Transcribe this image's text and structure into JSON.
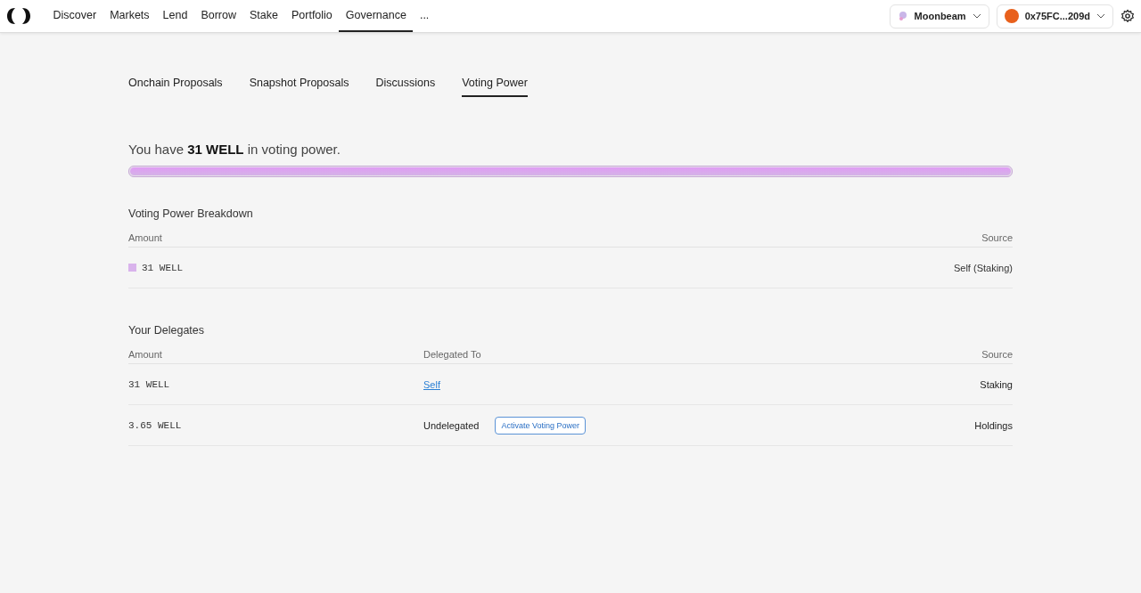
{
  "nav": {
    "items": [
      {
        "label": "Discover",
        "selected": false
      },
      {
        "label": "Markets",
        "selected": false
      },
      {
        "label": "Lend",
        "selected": false
      },
      {
        "label": "Borrow",
        "selected": false
      },
      {
        "label": "Stake",
        "selected": false
      },
      {
        "label": "Portfolio",
        "selected": false
      },
      {
        "label": "Governance",
        "selected": true
      },
      {
        "label": "...",
        "selected": false
      }
    ],
    "network": "Moonbeam",
    "account": "0x75FC...209d"
  },
  "tabs": [
    {
      "label": "Onchain Proposals",
      "selected": false
    },
    {
      "label": "Snapshot Proposals",
      "selected": false
    },
    {
      "label": "Discussions",
      "selected": false
    },
    {
      "label": "Voting Power",
      "selected": true
    }
  ],
  "summary": {
    "text": "You have **31 WELL** in voting power.",
    "level": 1
  },
  "breakdown": {
    "title": "Voting Power Breakdown",
    "columns": [
      "Amount",
      "Source"
    ],
    "rows": [
      {
        "amount": "31 WELL",
        "source": "Self (Staking)",
        "color": "#d9b3ec"
      }
    ]
  },
  "delegates": {
    "title": "Your Delegates",
    "columns": [
      "Amount",
      "Delegated To",
      "Source"
    ],
    "rows": [
      {
        "kind": "link",
        "amount": "31 WELL",
        "delegated_to": "Self",
        "source": "Staking"
      },
      {
        "kind": "undelegated",
        "amount": "3.65 WELL",
        "delegated_to": "Undelegated",
        "action": "Activate Voting Power",
        "source": "Holdings"
      }
    ]
  }
}
